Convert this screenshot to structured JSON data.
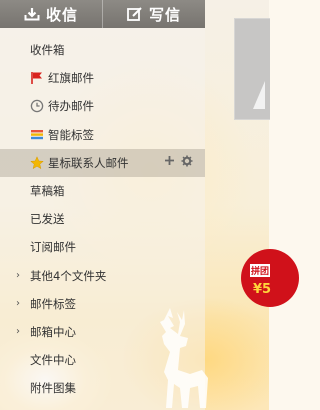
{
  "toolbar": {
    "inbox_label": "收信",
    "compose_label": "写信"
  },
  "nav": {
    "inbox": "收件箱",
    "flagged": "红旗邮件",
    "todo": "待办邮件",
    "smart_tags": "智能标签",
    "starred_contacts": "星标联系人邮件",
    "drafts": "草稿箱",
    "sent": "已发送",
    "subscriptions": "订阅邮件",
    "other_folders": "其他4个文件夹",
    "mail_tags": "邮件标签",
    "mailbox_center": "邮箱中心",
    "file_center": "文件中心",
    "attachments": "附件图集"
  },
  "promo": {
    "line1": "拼团",
    "line2": "¥5"
  },
  "colors": {
    "flag": "#d9231e",
    "star": "#f2b705",
    "badge": "#d0111a",
    "topbar": "#7f7c77"
  },
  "icons": [
    "download-icon",
    "compose-icon",
    "flag-icon",
    "clock-icon",
    "tags-icon",
    "star-icon",
    "plus-icon",
    "gear-icon",
    "chevron-right-icon",
    "deer-illustration"
  ]
}
